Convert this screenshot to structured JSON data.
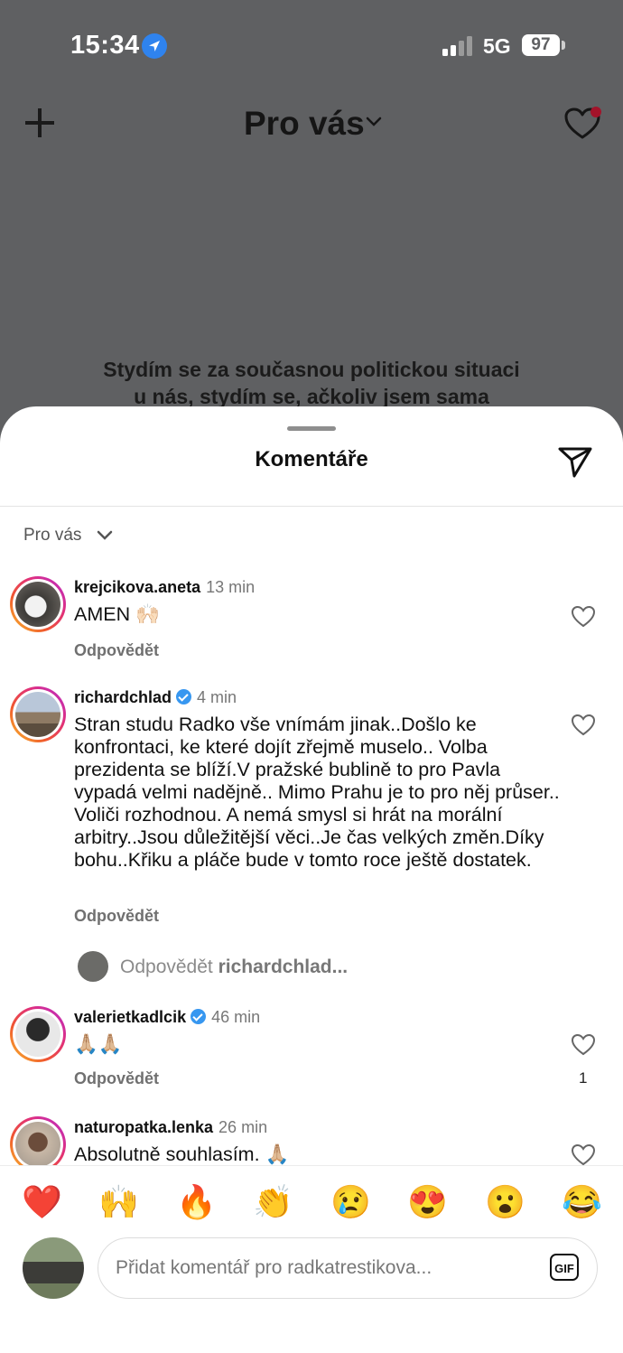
{
  "status_bar": {
    "time": "15:34",
    "network": "5G",
    "battery": "97"
  },
  "feed_header": {
    "title": "Pro vás"
  },
  "post_caption": {
    "line1": "Stydím se za současnou politickou situaci",
    "line2": "u nás, stydím se, ačkoliv jsem sama"
  },
  "comments_sheet": {
    "title": "Komentáře",
    "sort_label": "Pro vás",
    "comments": [
      {
        "username": "krejcikova.aneta",
        "time": "13 min",
        "verified": false,
        "text": "AMEN 🙌🏻",
        "reply_label": "Odpovědět",
        "likes": ""
      },
      {
        "username": "richardchlad",
        "time": "4 min",
        "verified": true,
        "text": "Stran studu Radko vše vnímám jinak..Došlo ke konfrontaci, ke které dojít zřejmě muselo.. Volba prezidenta se blíží.V pražské bublině to pro Pavla vypadá velmi nadějně.. Mimo Prahu je to pro něj průser.. Voliči rozhodnou. A nemá smysl si hrát na morální arbitry..Jsou důležitější věci..Je čas velkých změn.Díky bohu..Křiku a pláče bude v tomto roce ještě dostatek.",
        "reply_label": "Odpovědět",
        "likes": ""
      },
      {
        "username": "valerietkadlcik",
        "time": "46 min",
        "verified": true,
        "text": "🙏🏼🙏🏼",
        "reply_label": "Odpovědět",
        "likes": "1"
      },
      {
        "username": "naturopatka.lenka",
        "time": "26 min",
        "verified": false,
        "text": "Absolutně souhlasím. 🙏🏼",
        "reply_label": "",
        "likes": ""
      }
    ],
    "reply_prompt": {
      "prefix": "Odpovědět",
      "target": "richardchlad..."
    }
  },
  "quick_reactions": [
    "❤️",
    "🙌",
    "🔥",
    "👏",
    "😢",
    "😍",
    "😮",
    "😂"
  ],
  "composer": {
    "placeholder": "Přidat komentář  pro radkatrestikova...",
    "gif_label": "GIF"
  },
  "colors": {
    "accent": "#3797f0",
    "overlay": "#5f6062",
    "notification": "#a3132a"
  }
}
